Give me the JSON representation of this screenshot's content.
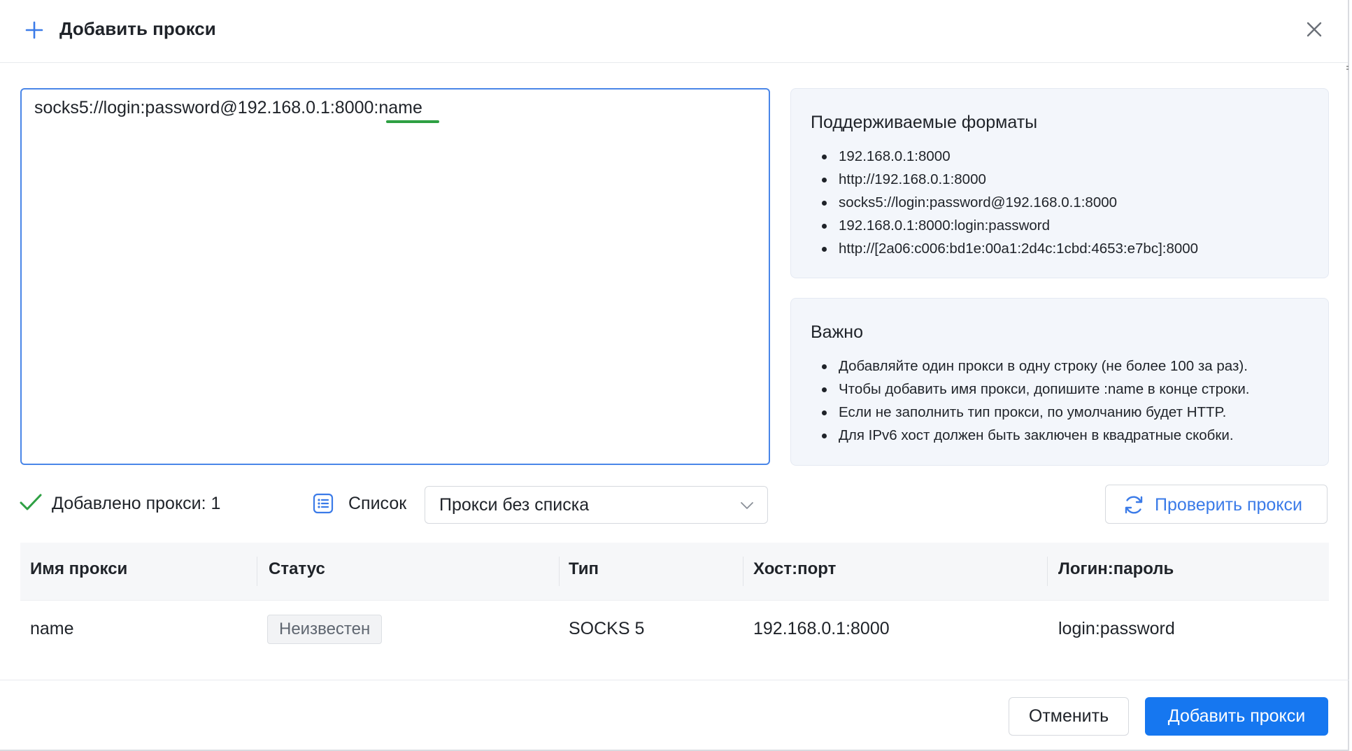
{
  "dialog": {
    "title": "Добавить прокси",
    "icons": {
      "add": "plus-icon",
      "close": "close-icon"
    }
  },
  "input": {
    "value": "socks5://login:password@192.168.0.1:8000:name"
  },
  "formats": {
    "title": "Поддерживаемые форматы",
    "items": [
      "192.168.0.1:8000",
      "http://192.168.0.1:8000",
      "socks5://login:password@192.168.0.1:8000",
      "192.168.0.1:8000:login:password",
      "http://[2a06:c006:bd1e:00a1:2d4c:1cbd:4653:e7bc]:8000"
    ]
  },
  "important": {
    "title": "Важно",
    "items": [
      "Добавляйте один прокси в одну строку (не более 100 за раз).",
      "Чтобы добавить имя прокси, допишите :name в конце строки.",
      "Если не заполнить тип прокси, по умолчанию будет HTTP.",
      "Для IPv6 хост должен быть заключен в квадратные скобки."
    ]
  },
  "status": {
    "added_label": "Добавлено прокси: 1",
    "list_label": "Список",
    "list_select_value": "Прокси без списка",
    "check_button_label": "Проверить прокси"
  },
  "table": {
    "columns": [
      "Имя прокси",
      "Статус",
      "Тип",
      "Хост:порт",
      "Логин:пароль"
    ],
    "rows": [
      {
        "name": "name",
        "status": "Неизвестен",
        "type": "SOCKS 5",
        "host_port": "192.168.0.1:8000",
        "login_password": "login:password"
      }
    ]
  },
  "footer": {
    "cancel_label": "Отменить",
    "add_label": "Добавить прокси"
  },
  "colors": {
    "accent": "#1677f0",
    "link": "#3b7be8",
    "success": "#2ea043",
    "info_bg": "#f3f6fb"
  }
}
